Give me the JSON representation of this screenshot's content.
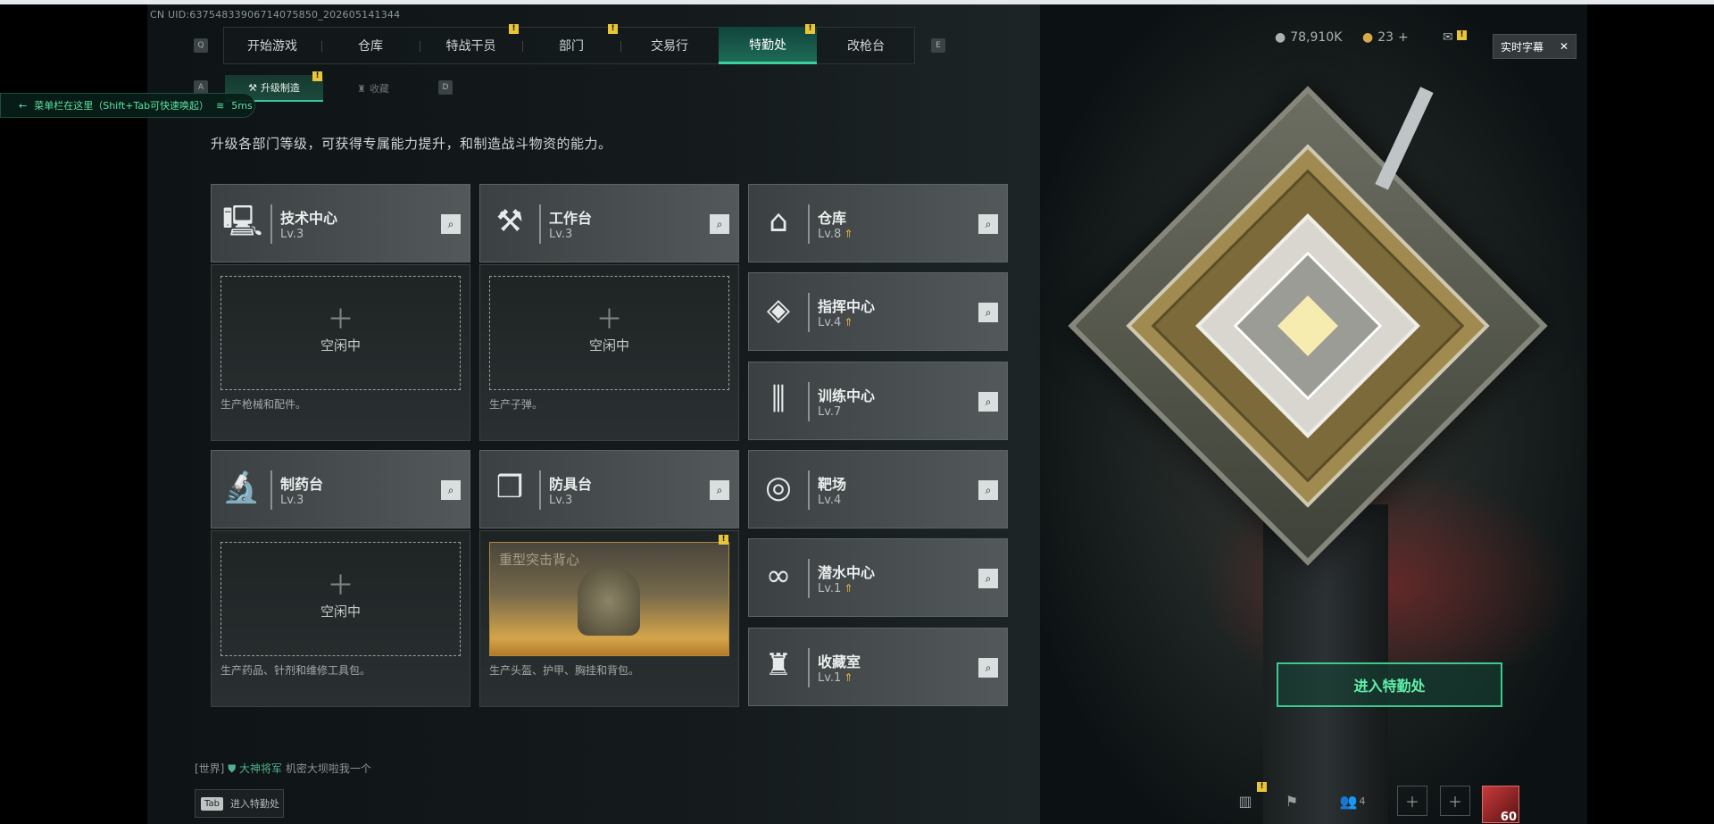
{
  "uid": "CN UID:63754833906714075850_202605141344",
  "nav": {
    "tabs": [
      "开始游戏",
      "仓库",
      "特战干员",
      "部门",
      "交易行",
      "特勤处",
      "改枪台"
    ],
    "left_key": "Q",
    "right_key": "E"
  },
  "subnav": {
    "tabs": [
      "升级制造",
      "收藏"
    ],
    "left_key": "A",
    "right_key": "D"
  },
  "toast": {
    "text": "菜单栏在这里（Shift+Tab可快速唤起）",
    "ping": "5ms"
  },
  "description": "升级各部门等级，可获得专属能力提升，和制造战斗物资的能力。",
  "currency": {
    "coins": "78,910K",
    "tickets": "23",
    "add": "+"
  },
  "captions": {
    "label": "实时字幕",
    "close": "✕"
  },
  "stations": [
    {
      "name": "技术中心",
      "level": "Lv.3",
      "icon": "computer-icon"
    },
    {
      "name": "工作台",
      "level": "Lv.3",
      "icon": "tools-icon"
    },
    {
      "name": "制药台",
      "level": "Lv.3",
      "icon": "microscope-icon"
    },
    {
      "name": "防具台",
      "level": "Lv.3",
      "icon": "cubes-icon"
    }
  ],
  "panels": [
    {
      "status": "空闲中",
      "desc": "生产枪械和配件。"
    },
    {
      "status": "空闲中",
      "desc": "生产子弹。"
    },
    {
      "status": "空闲中",
      "desc": "生产药品、针剂和维修工具包。"
    },
    {
      "item": "重型突击背心",
      "desc": "生产头盔、护甲、胸挂和背包。"
    }
  ],
  "facilities": [
    {
      "name": "仓库",
      "level": "Lv.8",
      "upgrade": true,
      "icon": "vault-icon"
    },
    {
      "name": "指挥中心",
      "level": "Lv.4",
      "upgrade": true,
      "icon": "command-icon"
    },
    {
      "name": "训练中心",
      "level": "Lv.7",
      "upgrade": false,
      "icon": "dumbbell-icon"
    },
    {
      "name": "靶场",
      "level": "Lv.4",
      "upgrade": false,
      "icon": "target-icon"
    },
    {
      "name": "潜水中心",
      "level": "Lv.1",
      "upgrade": true,
      "icon": "goggles-icon"
    },
    {
      "name": "收藏室",
      "level": "Lv.1",
      "upgrade": true,
      "icon": "trophy-icon"
    }
  ],
  "enter_button": "进入特勤处",
  "chat": {
    "channel": "[世界]",
    "user": "大神将军",
    "message": "机密大坝啦我一个"
  },
  "tab_hint": {
    "key": "Tab",
    "label": "进入特勤处"
  },
  "bottom": {
    "friends": "4",
    "level": "60"
  },
  "colors": {
    "accent": "#3ad19d",
    "warning": "#e9c53a",
    "upgrade": "#e8b641"
  }
}
